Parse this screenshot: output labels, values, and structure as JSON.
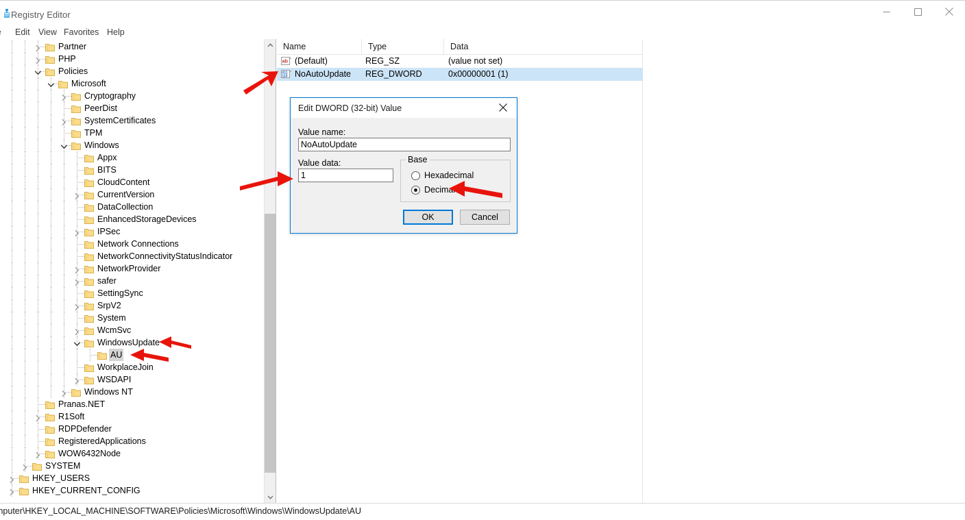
{
  "window": {
    "title": "Registry Editor",
    "icon": "registry-editor-icon",
    "controls": {
      "minimize": "minimize-icon",
      "maximize": "maximize-icon",
      "close": "close-icon"
    }
  },
  "menubar": {
    "items": [
      {
        "label": "le",
        "name": "menu-file"
      },
      {
        "label": "Edit",
        "name": "menu-edit"
      },
      {
        "label": "View",
        "name": "menu-view"
      },
      {
        "label": "Favorites",
        "name": "menu-favorites"
      },
      {
        "label": "Help",
        "name": "menu-help"
      }
    ]
  },
  "tree": {
    "rows": [
      {
        "label": "Partner",
        "depth": 2,
        "state": "collapsed",
        "selected": false
      },
      {
        "label": "PHP",
        "depth": 2,
        "state": "collapsed",
        "selected": false
      },
      {
        "label": "Policies",
        "depth": 2,
        "state": "expanded",
        "selected": false
      },
      {
        "label": "Microsoft",
        "depth": 3,
        "state": "expanded",
        "selected": false
      },
      {
        "label": "Cryptography",
        "depth": 4,
        "state": "collapsed",
        "selected": false
      },
      {
        "label": "PeerDist",
        "depth": 4,
        "state": "leaf",
        "selected": false
      },
      {
        "label": "SystemCertificates",
        "depth": 4,
        "state": "collapsed",
        "selected": false
      },
      {
        "label": "TPM",
        "depth": 4,
        "state": "leaf",
        "selected": false
      },
      {
        "label": "Windows",
        "depth": 4,
        "state": "expanded",
        "selected": false
      },
      {
        "label": "Appx",
        "depth": 5,
        "state": "leaf",
        "selected": false
      },
      {
        "label": "BITS",
        "depth": 5,
        "state": "leaf",
        "selected": false
      },
      {
        "label": "CloudContent",
        "depth": 5,
        "state": "leaf",
        "selected": false
      },
      {
        "label": "CurrentVersion",
        "depth": 5,
        "state": "collapsed",
        "selected": false
      },
      {
        "label": "DataCollection",
        "depth": 5,
        "state": "leaf",
        "selected": false
      },
      {
        "label": "EnhancedStorageDevices",
        "depth": 5,
        "state": "leaf",
        "selected": false
      },
      {
        "label": "IPSec",
        "depth": 5,
        "state": "collapsed",
        "selected": false
      },
      {
        "label": "Network Connections",
        "depth": 5,
        "state": "leaf",
        "selected": false
      },
      {
        "label": "NetworkConnectivityStatusIndicator",
        "depth": 5,
        "state": "leaf",
        "selected": false
      },
      {
        "label": "NetworkProvider",
        "depth": 5,
        "state": "collapsed",
        "selected": false
      },
      {
        "label": "safer",
        "depth": 5,
        "state": "collapsed",
        "selected": false
      },
      {
        "label": "SettingSync",
        "depth": 5,
        "state": "leaf",
        "selected": false
      },
      {
        "label": "SrpV2",
        "depth": 5,
        "state": "collapsed",
        "selected": false
      },
      {
        "label": "System",
        "depth": 5,
        "state": "leaf",
        "selected": false
      },
      {
        "label": "WcmSvc",
        "depth": 5,
        "state": "collapsed",
        "selected": false
      },
      {
        "label": "WindowsUpdate",
        "depth": 5,
        "state": "expanded",
        "selected": false
      },
      {
        "label": "AU",
        "depth": 6,
        "state": "leaf",
        "selected": true
      },
      {
        "label": "WorkplaceJoin",
        "depth": 5,
        "state": "leaf",
        "selected": false
      },
      {
        "label": "WSDAPI",
        "depth": 5,
        "state": "collapsed",
        "selected": false
      },
      {
        "label": "Windows NT",
        "depth": 4,
        "state": "collapsed",
        "selected": false
      },
      {
        "label": "Pranas.NET",
        "depth": 2,
        "state": "leaf",
        "selected": false
      },
      {
        "label": "R1Soft",
        "depth": 2,
        "state": "collapsed",
        "selected": false
      },
      {
        "label": "RDPDefender",
        "depth": 2,
        "state": "leaf",
        "selected": false
      },
      {
        "label": "RegisteredApplications",
        "depth": 2,
        "state": "leaf",
        "selected": false
      },
      {
        "label": "WOW6432Node",
        "depth": 2,
        "state": "collapsed",
        "selected": false
      },
      {
        "label": "SYSTEM",
        "depth": 1,
        "state": "collapsed",
        "selected": false
      },
      {
        "label": "HKEY_USERS",
        "depth": 0,
        "state": "collapsed",
        "selected": false
      },
      {
        "label": "HKEY_CURRENT_CONFIG",
        "depth": 0,
        "state": "collapsed",
        "selected": false
      }
    ]
  },
  "list": {
    "columns": [
      "Name",
      "Type",
      "Data"
    ],
    "rows": [
      {
        "icon": "string-value-icon",
        "name": "(Default)",
        "type": "REG_SZ",
        "data": "(value not set)",
        "selected": false
      },
      {
        "icon": "dword-value-icon",
        "name": "NoAutoUpdate",
        "type": "REG_DWORD",
        "data": "0x00000001 (1)",
        "selected": true
      }
    ]
  },
  "dialog": {
    "title": "Edit DWORD (32-bit) Value",
    "close_icon": "close-icon",
    "value_name_label": "Value name:",
    "value_name": "NoAutoUpdate",
    "value_data_label": "Value data:",
    "value_data": "1",
    "base_legend": "Base",
    "base_options": [
      {
        "label": "Hexadecimal",
        "checked": false
      },
      {
        "label": "Decimal",
        "checked": true
      }
    ],
    "ok_label": "OK",
    "cancel_label": "Cancel"
  },
  "statusbar": {
    "path": "mputer\\HKEY_LOCAL_MACHINE\\SOFTWARE\\Policies\\Microsoft\\Windows\\WindowsUpdate\\AU"
  },
  "annotations": {
    "arrow_color": "#e8140c",
    "arrows": [
      {
        "name": "arrow-to-noautoupdate-row",
        "target": "NoAutoUpdate list row"
      },
      {
        "name": "arrow-to-value-data-field",
        "target": "Value data input"
      },
      {
        "name": "arrow-to-decimal-radio",
        "target": "Decimal radio button"
      },
      {
        "name": "arrow-to-windowsupdate-key",
        "target": "WindowsUpdate tree key"
      },
      {
        "name": "arrow-to-au-key",
        "target": "AU tree key"
      }
    ]
  },
  "colors": {
    "accent": "#0078d7",
    "selection_list": "#cce4f7",
    "selection_tree": "#d4d4d4",
    "folder": "#fbdc8a",
    "arrow": "#e8140c"
  }
}
